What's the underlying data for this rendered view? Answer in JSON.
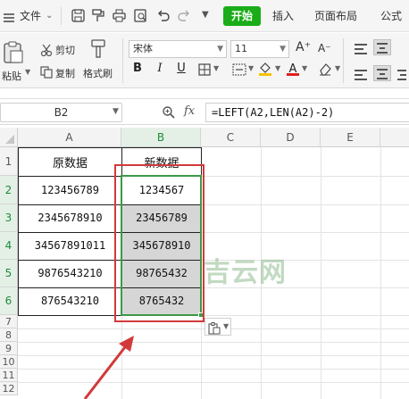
{
  "menu": {
    "file_label": "文件",
    "tabs": [
      "开始",
      "插入",
      "页面布局",
      "公式"
    ]
  },
  "ribbon": {
    "cut_label": "剪切",
    "copy_label": "复制",
    "paste_label": "粘贴",
    "format_painter_label": "格式刷",
    "font_name": "宋体",
    "font_size": "11",
    "increase_font": "A⁺",
    "decrease_font": "A⁻",
    "bold": "B",
    "italic": "I",
    "underline": "U",
    "font_color_letter": "A"
  },
  "formula_bar": {
    "name_box": "B2",
    "fx": "fx",
    "formula": "=LEFT(A2,LEN(A2)-2)"
  },
  "sheet": {
    "columns": [
      "A",
      "B",
      "C",
      "D",
      "E"
    ],
    "rows": [
      "1",
      "2",
      "3",
      "4",
      "5",
      "6",
      "7",
      "8",
      "9",
      "10",
      "11",
      "12"
    ],
    "col_a_header": "原数据",
    "col_b_header": "新数据",
    "col_a_values": [
      "123456789",
      "2345678910",
      "34567891011",
      "9876543210",
      "876543210"
    ],
    "col_b_values": [
      "1234567",
      "23456789",
      "345678910",
      "98765432",
      "8765432"
    ]
  },
  "watermark": "吉云网",
  "colors": {
    "accent_green": "#1aad19",
    "selection_green": "#3c9a46",
    "highlight_red": "#d23a3a"
  }
}
